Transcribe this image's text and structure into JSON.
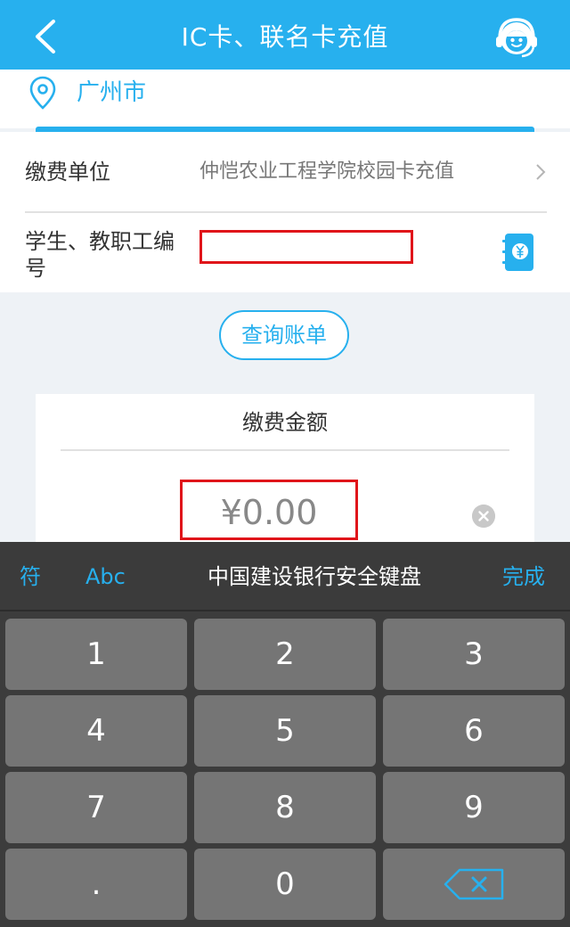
{
  "header": {
    "title": "IC卡、联名卡充值"
  },
  "location": {
    "city": "广州市"
  },
  "form": {
    "unit_label": "缴费单位",
    "unit_value": "仲恺农业工程学院校园卡充值",
    "id_label": "学生、教职工编号",
    "id_value": ""
  },
  "query": {
    "button_label": "查询账单"
  },
  "amount": {
    "title": "缴费金额",
    "value": "¥0.00"
  },
  "keyboard": {
    "symbol_label": "符",
    "abc_label": "Abc",
    "title": "中国建设银行安全键盘",
    "done_label": "完成",
    "keys": [
      "1",
      "2",
      "3",
      "4",
      "5",
      "6",
      "7",
      "8",
      "9",
      ".",
      "0"
    ]
  },
  "colors": {
    "brand": "#27b0ee",
    "highlight": "#e0151a",
    "keyboard_bg": "#3c3c3c",
    "key_bg": "#757575"
  },
  "icons": {
    "back": "back-arrow-icon",
    "service": "customer-service-icon",
    "location": "location-pin-icon",
    "chevron": "chevron-right-icon",
    "ledger": "ledger-yuan-icon",
    "clear": "clear-icon",
    "backspace": "backspace-icon"
  }
}
